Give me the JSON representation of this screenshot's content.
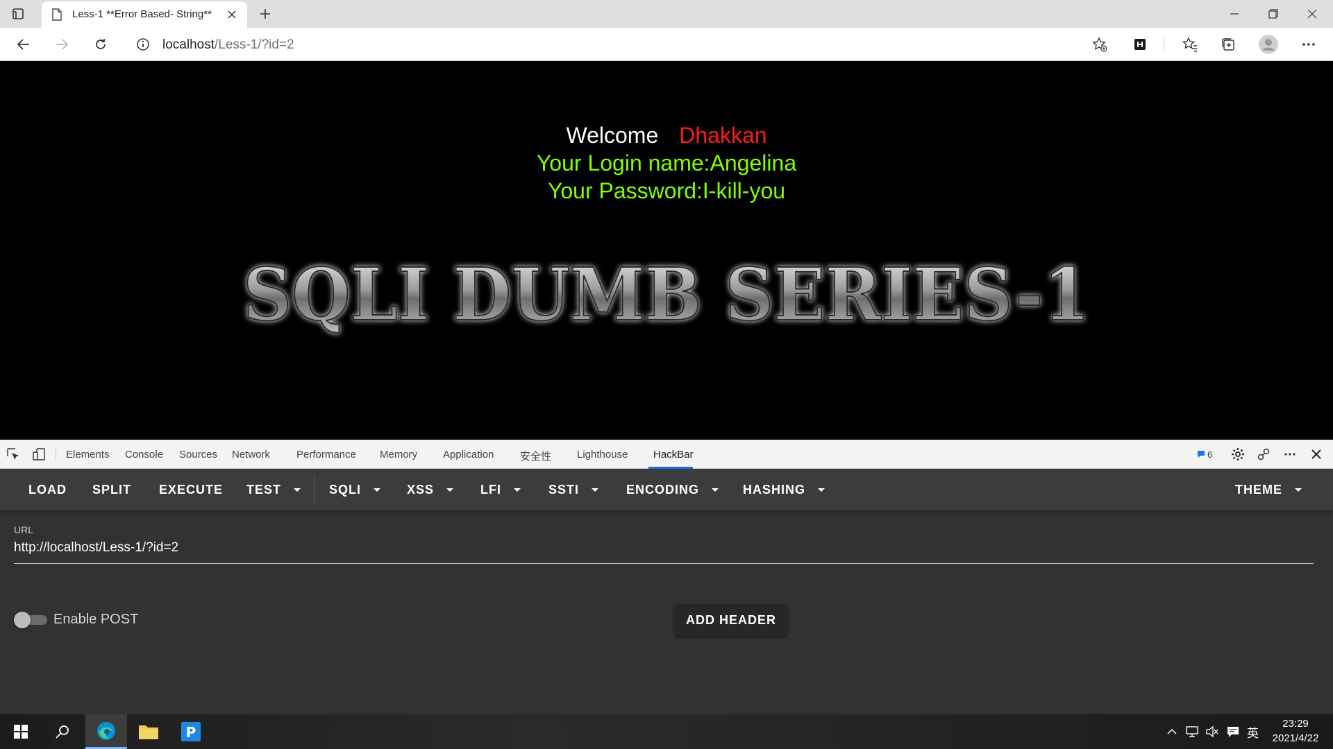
{
  "browser": {
    "tab_title": "Less-1 **Error Based- String**",
    "url_host": "localhost",
    "url_path": "/Less-1/?id=2"
  },
  "page": {
    "welcome_word": "Welcome",
    "welcome_name": "Dhakkan",
    "login_line": "Your Login name:Angelina",
    "password_line": "Your Password:I-kill-you",
    "banner_text": "SQLI DUMB SERIES-1"
  },
  "devtools": {
    "tabs": [
      "Elements",
      "Console",
      "Sources",
      "Network",
      "Performance",
      "Memory",
      "Application",
      "安全性",
      "Lighthouse",
      "HackBar"
    ],
    "issues_count": "6"
  },
  "hackbar": {
    "buttons": {
      "load": "LOAD",
      "split": "SPLIT",
      "execute": "EXECUTE",
      "test": "TEST",
      "sqli": "SQLI",
      "xss": "XSS",
      "lfi": "LFI",
      "ssti": "SSTI",
      "encoding": "ENCODING",
      "hashing": "HASHING",
      "theme": "THEME"
    },
    "url_label": "URL",
    "url_value": "http://localhost/Less-1/?id=2",
    "enable_post_label": "Enable POST",
    "enable_post": false,
    "add_header_label": "ADD HEADER"
  },
  "taskbar": {
    "ime": "英",
    "time": "23:29",
    "date": "2021/4/22"
  },
  "colors": {
    "welcome_name": "#ff1a1a",
    "login_text": "#7fff00",
    "hackbar_bg": "#323232",
    "hackbar_toolbar": "#3c3c3c",
    "devtools_active_tab": "#1a73e8"
  }
}
